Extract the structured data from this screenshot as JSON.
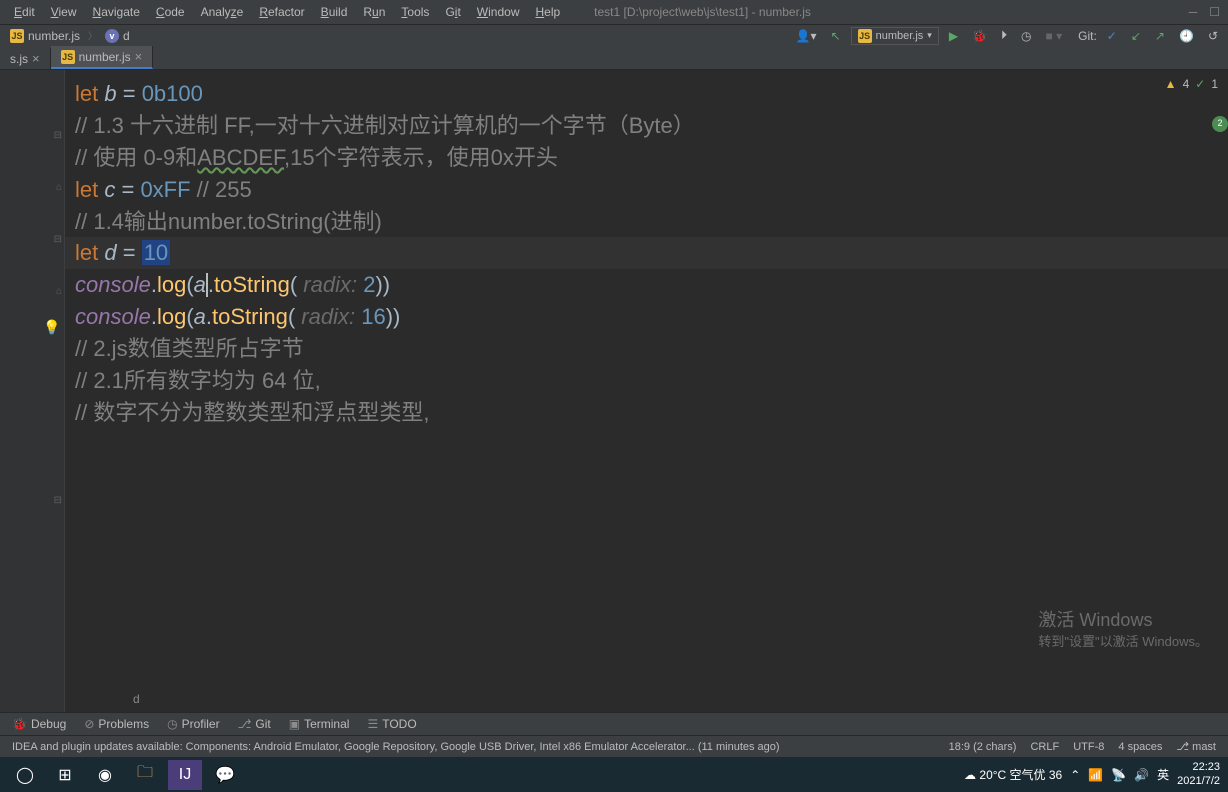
{
  "menu": {
    "items": [
      "Edit",
      "View",
      "Navigate",
      "Code",
      "Analyze",
      "Refactor",
      "Build",
      "Run",
      "Tools",
      "Git",
      "Window",
      "Help"
    ],
    "title": "test1 [D:\\project\\web\\js\\test1] - number.js"
  },
  "nav": {
    "file": "number.js",
    "var": "d",
    "run_config": "number.js",
    "git_label": "Git:"
  },
  "tabs": {
    "left": "s.js",
    "active": "number.js"
  },
  "inspections": {
    "warn": "4",
    "check": "1"
  },
  "code": {
    "l1_kw": "let ",
    "l1_ident": "b",
    "l1_op": " = ",
    "l1_num": "0b100",
    "l2": "// 1.3 十六进制 FF,一对十六进制对应计算机的一个字节（Byte）",
    "l3a": "// 使用 0-9和",
    "l3b": "ABCDEF",
    "l3c": ",15个字符表示，使用0x开头",
    "l4_kw": "let ",
    "l4_ident": "c",
    "l4_op": " = ",
    "l4_num": "0xFF",
    "l4_cmt": " // 255",
    "l5": "// 1.4输出number.toString(进制)",
    "l6_kw": "let ",
    "l6_ident": "d",
    "l6_op": " = ",
    "l6_num": "10",
    "l7_obj": "console",
    "l7_dot": ".",
    "l7_fn": "log",
    "l7_p1": "(",
    "l7_a": "a",
    "l7_d2": ".",
    "l7_ts": "toString",
    "l7_p2": "(",
    "l7_hint": " radix: ",
    "l7_arg": "2",
    "l7_close": "))",
    "l8_arg": "16",
    "l9": "// 2.js数值类型所占字节",
    "l10": "// 2.1所有数字均为 64 位,",
    "l11": "// 数字不分为整数类型和浮点型类型,",
    "breadcrumb": "d"
  },
  "bottom_tools": {
    "debug": "Debug",
    "problems": "Problems",
    "profiler": "Profiler",
    "git": "Git",
    "terminal": "Terminal",
    "todo": "TODO"
  },
  "status": {
    "msg": "IDEA and plugin updates available: Components: Android Emulator, Google Repository, Google USB Driver, Intel x86 Emulator Accelerator... (11 minutes ago)",
    "pos": "18:9 (2 chars)",
    "lf": "CRLF",
    "enc": "UTF-8",
    "indent": "4 spaces",
    "branch": "mast"
  },
  "watermark": {
    "title": "激活 Windows",
    "sub": "转到\"设置\"以激活 Windows。"
  },
  "taskbar": {
    "weather": "20°C 空气优 36",
    "ime": "英",
    "time": "22:23",
    "date": "2021/7/2"
  }
}
